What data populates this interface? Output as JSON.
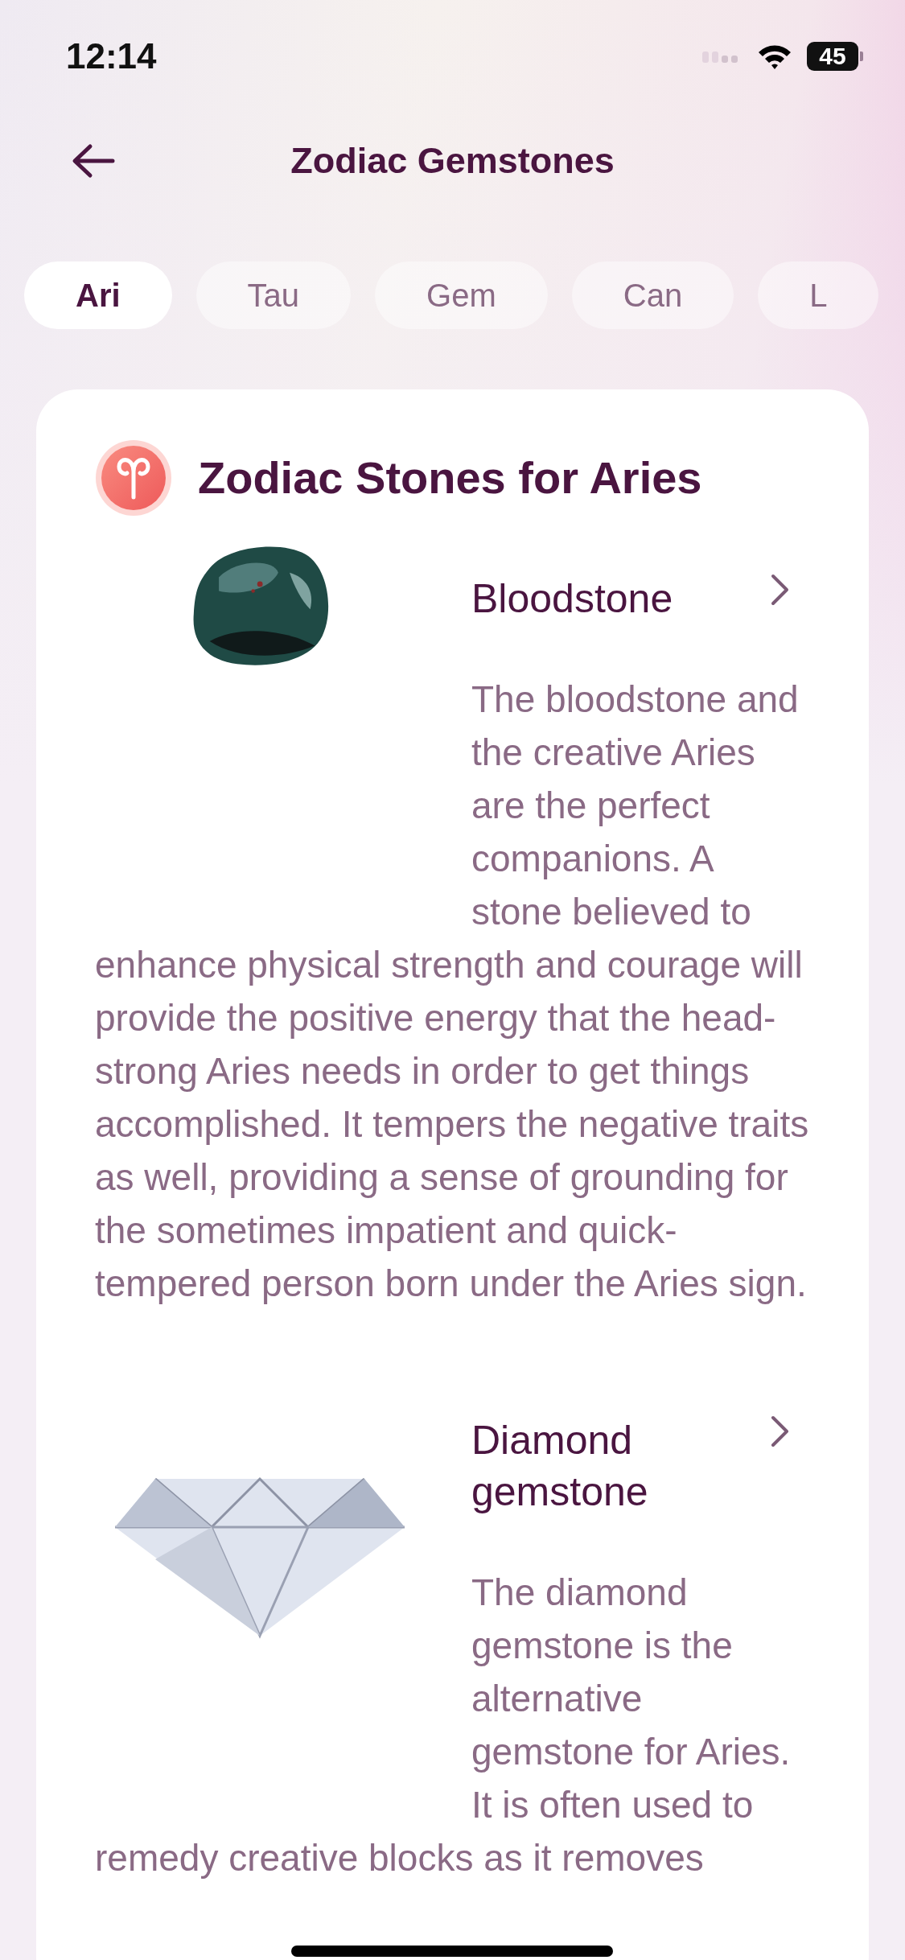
{
  "status_bar": {
    "time": "12:14",
    "battery": "45"
  },
  "header": {
    "title": "Zodiac Gemstones"
  },
  "tabs": [
    {
      "label": "Ari",
      "selected": true
    },
    {
      "label": "Tau",
      "selected": false
    },
    {
      "label": "Gem",
      "selected": false
    },
    {
      "label": "Can",
      "selected": false
    },
    {
      "label": "L",
      "selected": false
    }
  ],
  "card": {
    "title": "Zodiac Stones for Aries",
    "stones": [
      {
        "kind": "bloodstone",
        "name": "Bloodstone",
        "description": "The bloodstone and the creative Aries are the perfect companions. A stone believed to enhance physical strength and courage will provide the positive energy that the head-strong Aries needs in order to get things accomplished. It tempers the negative traits as well, providing a sense of grounding for the sometimes impatient and quick-tempered person born under the Aries sign."
      },
      {
        "kind": "diamond",
        "name": "Diamond gemstone",
        "description": "The diamond gemstone is the alternative gemstone for Aries. It is often used to remedy creative blocks as it removes"
      }
    ]
  }
}
